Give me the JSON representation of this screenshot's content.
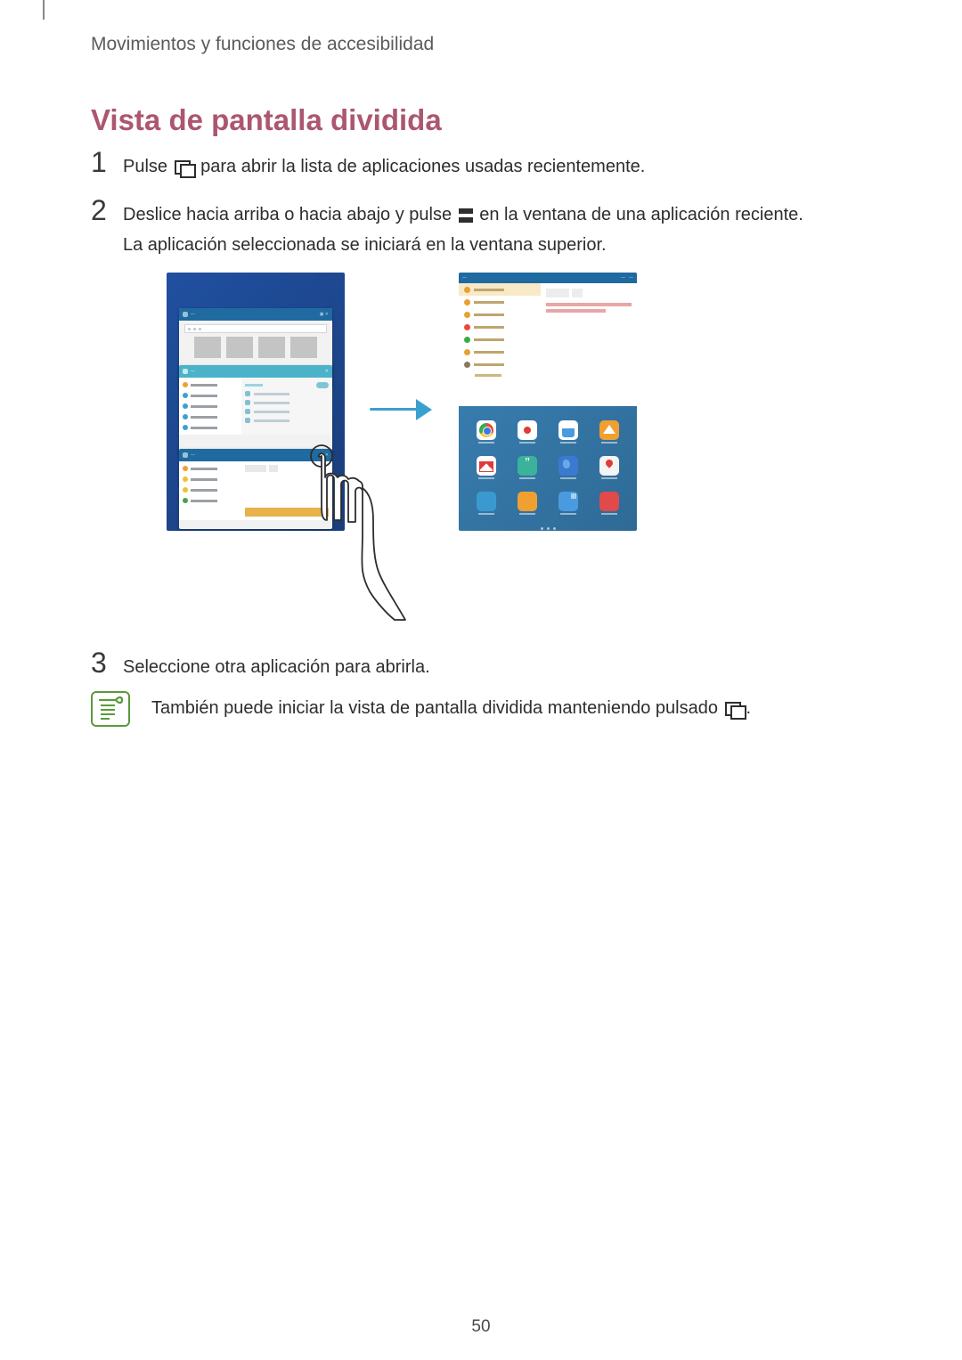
{
  "header": "Movimientos y funciones de accesibilidad",
  "title": "Vista de pantalla dividida",
  "steps": {
    "1": {
      "num": "1",
      "pre": "Pulse ",
      "post": " para abrir la lista de aplicaciones usadas recientemente."
    },
    "2": {
      "num": "2",
      "line1_pre": "Deslice hacia arriba o hacia abajo y pulse ",
      "line1_post": " en la ventana de una aplicación reciente.",
      "line2": "La aplicación seleccionada se iniciará en la ventana superior."
    },
    "3": {
      "num": "3",
      "text": "Seleccione otra aplicación para abrirla."
    }
  },
  "note": {
    "pre": "También puede iniciar la vista de pantalla dividida manteniendo pulsado ",
    "post": "."
  },
  "page_number": "50"
}
